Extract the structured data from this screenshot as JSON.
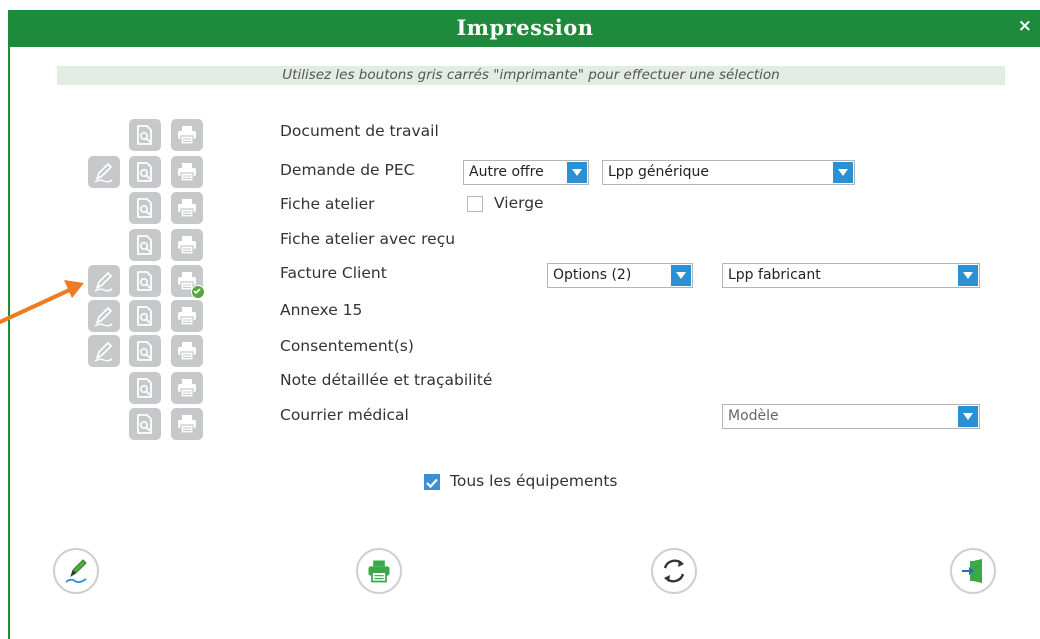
{
  "dialog": {
    "title": "Impression",
    "close_label": "×",
    "hint": "Utilisez les boutons gris carrés \"imprimante\" pour effectuer une sélection"
  },
  "rows": [
    {
      "label": "Document de travail",
      "has_sign": false,
      "print_checked": false
    },
    {
      "label": "Demande de PEC",
      "has_sign": true,
      "print_checked": false
    },
    {
      "label": "Fiche atelier",
      "has_sign": false,
      "print_checked": false
    },
    {
      "label": "Fiche atelier avec reçu",
      "has_sign": false,
      "print_checked": false
    },
    {
      "label": "Facture Client",
      "has_sign": true,
      "print_checked": true
    },
    {
      "label": "Annexe 15",
      "has_sign": true,
      "print_checked": false
    },
    {
      "label": "Consentement(s)",
      "has_sign": true,
      "print_checked": false
    },
    {
      "label": "Note détaillée et traçabilité",
      "has_sign": false,
      "print_checked": false
    },
    {
      "label": "Courrier médical",
      "has_sign": false,
      "print_checked": false
    }
  ],
  "controls": {
    "pec_offer": "Autre offre",
    "pec_lpp": "Lpp générique",
    "fiche_vierge_label": "Vierge",
    "fiche_vierge_checked": false,
    "facture_options": "Options (2)",
    "facture_lpp": "Lpp fabricant",
    "courrier_model": "Modèle",
    "all_equipments_label": "Tous les équipements",
    "all_equipments_checked": true
  },
  "colors": {
    "header_green": "#1e8a3c",
    "hint_bg": "#e2ece3",
    "select_arrow_blue": "#2b8fd4",
    "icon_gray": "#c6c8c9",
    "annotation_arrow": "#f07b22"
  },
  "icons": {
    "row_buttons": [
      "sign-icon",
      "preview-icon",
      "printer-icon"
    ],
    "actions": [
      "sign-pen-icon",
      "print-icon",
      "refresh-icon",
      "exit-icon"
    ]
  }
}
